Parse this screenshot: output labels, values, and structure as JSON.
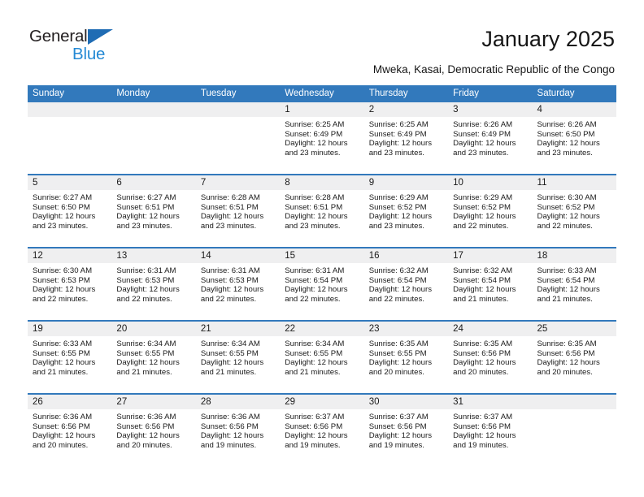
{
  "brand": {
    "name_top": "General",
    "name_bottom": "Blue",
    "triangle_color": "#1f6cb4",
    "blue_text_color": "#2489d4",
    "dark_text_color": "#231f20"
  },
  "header": {
    "title": "January 2025",
    "subtitle": "Mweka, Kasai, Democratic Republic of the Congo",
    "accent_color": "#3279bc",
    "daynum_band_color": "#efeff0"
  },
  "calendar": {
    "weekday_headers": [
      "Sunday",
      "Monday",
      "Tuesday",
      "Wednesday",
      "Thursday",
      "Friday",
      "Saturday"
    ],
    "weeks": [
      {
        "cells": [
          {
            "day": "",
            "empty": true,
            "sunrise": "",
            "sunset": "",
            "daylight_line1": "",
            "daylight_line2": ""
          },
          {
            "day": "",
            "empty": true,
            "sunrise": "",
            "sunset": "",
            "daylight_line1": "",
            "daylight_line2": ""
          },
          {
            "day": "",
            "empty": true,
            "sunrise": "",
            "sunset": "",
            "daylight_line1": "",
            "daylight_line2": ""
          },
          {
            "day": "1",
            "empty": false,
            "sunrise": "Sunrise: 6:25 AM",
            "sunset": "Sunset: 6:49 PM",
            "daylight_line1": "Daylight: 12 hours",
            "daylight_line2": "and 23 minutes."
          },
          {
            "day": "2",
            "empty": false,
            "sunrise": "Sunrise: 6:25 AM",
            "sunset": "Sunset: 6:49 PM",
            "daylight_line1": "Daylight: 12 hours",
            "daylight_line2": "and 23 minutes."
          },
          {
            "day": "3",
            "empty": false,
            "sunrise": "Sunrise: 6:26 AM",
            "sunset": "Sunset: 6:49 PM",
            "daylight_line1": "Daylight: 12 hours",
            "daylight_line2": "and 23 minutes."
          },
          {
            "day": "4",
            "empty": false,
            "sunrise": "Sunrise: 6:26 AM",
            "sunset": "Sunset: 6:50 PM",
            "daylight_line1": "Daylight: 12 hours",
            "daylight_line2": "and 23 minutes."
          }
        ]
      },
      {
        "cells": [
          {
            "day": "5",
            "empty": false,
            "sunrise": "Sunrise: 6:27 AM",
            "sunset": "Sunset: 6:50 PM",
            "daylight_line1": "Daylight: 12 hours",
            "daylight_line2": "and 23 minutes."
          },
          {
            "day": "6",
            "empty": false,
            "sunrise": "Sunrise: 6:27 AM",
            "sunset": "Sunset: 6:51 PM",
            "daylight_line1": "Daylight: 12 hours",
            "daylight_line2": "and 23 minutes."
          },
          {
            "day": "7",
            "empty": false,
            "sunrise": "Sunrise: 6:28 AM",
            "sunset": "Sunset: 6:51 PM",
            "daylight_line1": "Daylight: 12 hours",
            "daylight_line2": "and 23 minutes."
          },
          {
            "day": "8",
            "empty": false,
            "sunrise": "Sunrise: 6:28 AM",
            "sunset": "Sunset: 6:51 PM",
            "daylight_line1": "Daylight: 12 hours",
            "daylight_line2": "and 23 minutes."
          },
          {
            "day": "9",
            "empty": false,
            "sunrise": "Sunrise: 6:29 AM",
            "sunset": "Sunset: 6:52 PM",
            "daylight_line1": "Daylight: 12 hours",
            "daylight_line2": "and 23 minutes."
          },
          {
            "day": "10",
            "empty": false,
            "sunrise": "Sunrise: 6:29 AM",
            "sunset": "Sunset: 6:52 PM",
            "daylight_line1": "Daylight: 12 hours",
            "daylight_line2": "and 22 minutes."
          },
          {
            "day": "11",
            "empty": false,
            "sunrise": "Sunrise: 6:30 AM",
            "sunset": "Sunset: 6:52 PM",
            "daylight_line1": "Daylight: 12 hours",
            "daylight_line2": "and 22 minutes."
          }
        ]
      },
      {
        "cells": [
          {
            "day": "12",
            "empty": false,
            "sunrise": "Sunrise: 6:30 AM",
            "sunset": "Sunset: 6:53 PM",
            "daylight_line1": "Daylight: 12 hours",
            "daylight_line2": "and 22 minutes."
          },
          {
            "day": "13",
            "empty": false,
            "sunrise": "Sunrise: 6:31 AM",
            "sunset": "Sunset: 6:53 PM",
            "daylight_line1": "Daylight: 12 hours",
            "daylight_line2": "and 22 minutes."
          },
          {
            "day": "14",
            "empty": false,
            "sunrise": "Sunrise: 6:31 AM",
            "sunset": "Sunset: 6:53 PM",
            "daylight_line1": "Daylight: 12 hours",
            "daylight_line2": "and 22 minutes."
          },
          {
            "day": "15",
            "empty": false,
            "sunrise": "Sunrise: 6:31 AM",
            "sunset": "Sunset: 6:54 PM",
            "daylight_line1": "Daylight: 12 hours",
            "daylight_line2": "and 22 minutes."
          },
          {
            "day": "16",
            "empty": false,
            "sunrise": "Sunrise: 6:32 AM",
            "sunset": "Sunset: 6:54 PM",
            "daylight_line1": "Daylight: 12 hours",
            "daylight_line2": "and 22 minutes."
          },
          {
            "day": "17",
            "empty": false,
            "sunrise": "Sunrise: 6:32 AM",
            "sunset": "Sunset: 6:54 PM",
            "daylight_line1": "Daylight: 12 hours",
            "daylight_line2": "and 21 minutes."
          },
          {
            "day": "18",
            "empty": false,
            "sunrise": "Sunrise: 6:33 AM",
            "sunset": "Sunset: 6:54 PM",
            "daylight_line1": "Daylight: 12 hours",
            "daylight_line2": "and 21 minutes."
          }
        ]
      },
      {
        "cells": [
          {
            "day": "19",
            "empty": false,
            "sunrise": "Sunrise: 6:33 AM",
            "sunset": "Sunset: 6:55 PM",
            "daylight_line1": "Daylight: 12 hours",
            "daylight_line2": "and 21 minutes."
          },
          {
            "day": "20",
            "empty": false,
            "sunrise": "Sunrise: 6:34 AM",
            "sunset": "Sunset: 6:55 PM",
            "daylight_line1": "Daylight: 12 hours",
            "daylight_line2": "and 21 minutes."
          },
          {
            "day": "21",
            "empty": false,
            "sunrise": "Sunrise: 6:34 AM",
            "sunset": "Sunset: 6:55 PM",
            "daylight_line1": "Daylight: 12 hours",
            "daylight_line2": "and 21 minutes."
          },
          {
            "day": "22",
            "empty": false,
            "sunrise": "Sunrise: 6:34 AM",
            "sunset": "Sunset: 6:55 PM",
            "daylight_line1": "Daylight: 12 hours",
            "daylight_line2": "and 21 minutes."
          },
          {
            "day": "23",
            "empty": false,
            "sunrise": "Sunrise: 6:35 AM",
            "sunset": "Sunset: 6:55 PM",
            "daylight_line1": "Daylight: 12 hours",
            "daylight_line2": "and 20 minutes."
          },
          {
            "day": "24",
            "empty": false,
            "sunrise": "Sunrise: 6:35 AM",
            "sunset": "Sunset: 6:56 PM",
            "daylight_line1": "Daylight: 12 hours",
            "daylight_line2": "and 20 minutes."
          },
          {
            "day": "25",
            "empty": false,
            "sunrise": "Sunrise: 6:35 AM",
            "sunset": "Sunset: 6:56 PM",
            "daylight_line1": "Daylight: 12 hours",
            "daylight_line2": "and 20 minutes."
          }
        ]
      },
      {
        "cells": [
          {
            "day": "26",
            "empty": false,
            "sunrise": "Sunrise: 6:36 AM",
            "sunset": "Sunset: 6:56 PM",
            "daylight_line1": "Daylight: 12 hours",
            "daylight_line2": "and 20 minutes."
          },
          {
            "day": "27",
            "empty": false,
            "sunrise": "Sunrise: 6:36 AM",
            "sunset": "Sunset: 6:56 PM",
            "daylight_line1": "Daylight: 12 hours",
            "daylight_line2": "and 20 minutes."
          },
          {
            "day": "28",
            "empty": false,
            "sunrise": "Sunrise: 6:36 AM",
            "sunset": "Sunset: 6:56 PM",
            "daylight_line1": "Daylight: 12 hours",
            "daylight_line2": "and 19 minutes."
          },
          {
            "day": "29",
            "empty": false,
            "sunrise": "Sunrise: 6:37 AM",
            "sunset": "Sunset: 6:56 PM",
            "daylight_line1": "Daylight: 12 hours",
            "daylight_line2": "and 19 minutes."
          },
          {
            "day": "30",
            "empty": false,
            "sunrise": "Sunrise: 6:37 AM",
            "sunset": "Sunset: 6:56 PM",
            "daylight_line1": "Daylight: 12 hours",
            "daylight_line2": "and 19 minutes."
          },
          {
            "day": "31",
            "empty": false,
            "sunrise": "Sunrise: 6:37 AM",
            "sunset": "Sunset: 6:56 PM",
            "daylight_line1": "Daylight: 12 hours",
            "daylight_line2": "and 19 minutes."
          },
          {
            "day": "",
            "empty": true,
            "sunrise": "",
            "sunset": "",
            "daylight_line1": "",
            "daylight_line2": ""
          }
        ]
      }
    ]
  }
}
